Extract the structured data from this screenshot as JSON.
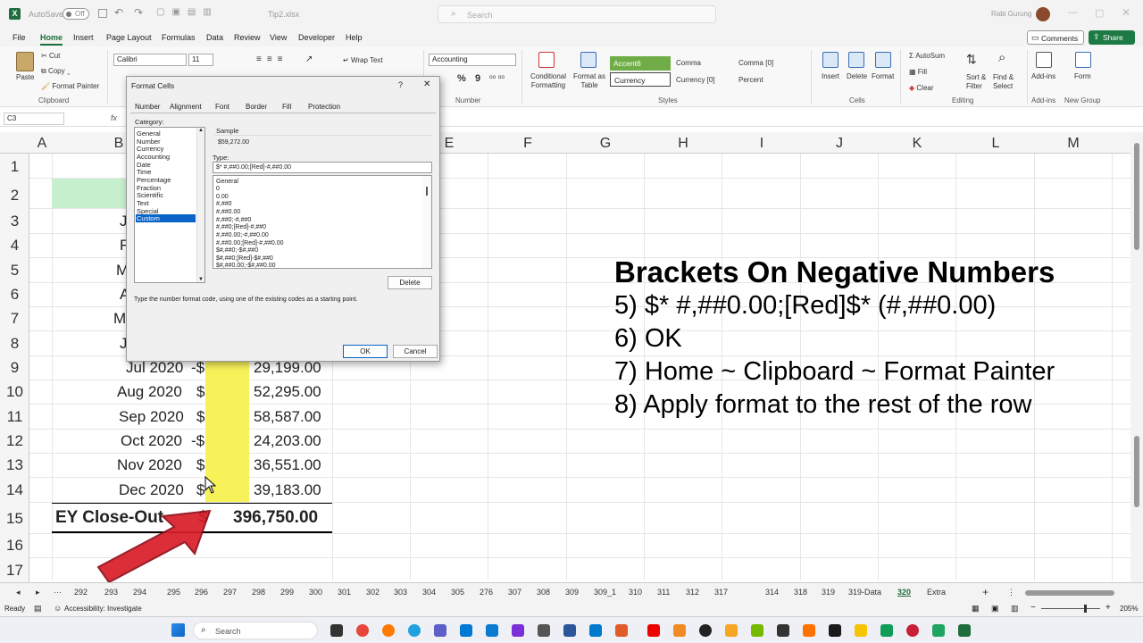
{
  "app": {
    "autosave_label": "AutoSave",
    "autosave_state": "Off",
    "filename": "Tip2.xlsx",
    "search_placeholder": "Search",
    "user_name": "Rabi Gurung"
  },
  "menu": [
    "File",
    "Home",
    "Insert",
    "Page Layout",
    "Formulas",
    "Data",
    "Review",
    "View",
    "Developer",
    "Help"
  ],
  "menu_active": "Home",
  "header_buttons": {
    "comments": "Comments",
    "share": "Share"
  },
  "ribbon": {
    "paste": "Paste",
    "cut": "Cut",
    "copy": "Copy",
    "format_painter": "Format Painter",
    "clipboard": "Clipboard",
    "font_name": "Calibri",
    "font_size": "11",
    "wrap_text": "Wrap Text",
    "number_format": "Accounting",
    "number_group": "Number",
    "percent_symbol": "%",
    "comma_symbol": "9",
    "conditional_formatting": "Conditional Formatting",
    "format_as_table": "Format as Table",
    "style_accent6": "Accent6",
    "style_comma": "Comma",
    "style_comma0": "Comma [0]",
    "style_currency": "Currency",
    "style_currency0": "Currency [0]",
    "style_percent": "Percent",
    "styles_group": "Styles",
    "insert": "Insert",
    "delete": "Delete",
    "format": "Format",
    "cells_group": "Cells",
    "autosum": "AutoSum",
    "fill": "Fill",
    "clear": "Clear",
    "sort_filter": "Sort & Filter",
    "find_select": "Find & Select",
    "editing_group": "Editing",
    "addins": "Add-ins",
    "addins_group": "Add-ins",
    "form": "Form",
    "new_group": "New Group"
  },
  "formula_bar": {
    "name_box": "C3",
    "fx": "fx"
  },
  "columns": [
    "A",
    "B",
    "E",
    "F",
    "G",
    "H",
    "I",
    "J",
    "K",
    "L",
    "M"
  ],
  "rows": [
    "1",
    "2",
    "3",
    "4",
    "5",
    "6",
    "7",
    "8",
    "9",
    "10",
    "11",
    "12",
    "13",
    "14",
    "15",
    "16",
    "17"
  ],
  "partial_b_letters": [
    "J",
    "F",
    "M",
    "A",
    "M",
    "J"
  ],
  "data_rows": [
    {
      "month": "Jul 2020",
      "sym": "-$",
      "amount": "29,199.00"
    },
    {
      "month": "Aug 2020",
      "sym": "$",
      "amount": "52,295.00"
    },
    {
      "month": "Sep 2020",
      "sym": "$",
      "amount": "58,587.00"
    },
    {
      "month": "Oct 2020",
      "sym": "-$",
      "amount": "24,203.00"
    },
    {
      "month": "Nov 2020",
      "sym": "$",
      "amount": "36,551.00"
    },
    {
      "month": "Dec 2020",
      "sym": "$",
      "amount": "39,183.00"
    }
  ],
  "total_row": {
    "label": "EY Close-Out",
    "sym": "$",
    "amount": "396,750.00"
  },
  "dialog": {
    "title": "Format Cells",
    "help": "?",
    "tabs": [
      "Number",
      "Alignment",
      "Font",
      "Border",
      "Fill",
      "Protection"
    ],
    "category_label": "Category:",
    "categories": [
      "General",
      "Number",
      "Currency",
      "Accounting",
      "Date",
      "Time",
      "Percentage",
      "Fraction",
      "Scientific",
      "Text",
      "Special",
      "Custom"
    ],
    "selected_category": "Custom",
    "sample_label": "Sample",
    "sample_value": "$59,272.00",
    "type_label": "Type:",
    "type_value": "$* #,##0.00;[Red]-#,##0.00",
    "type_list": [
      "General",
      "0",
      "0.00",
      "#,##0",
      "#,##0.00",
      "#,##0;-#,##0",
      "#,##0;[Red]-#,##0",
      "#,##0.00;-#,##0.00",
      "#,##0.00;[Red]-#,##0.00",
      "$#,##0;-$#,##0",
      "$#,##0;[Red]-$#,##0",
      "$#,##0.00;-$#,##0.00"
    ],
    "delete": "Delete",
    "hint": "Type the number format code, using one of the existing codes as a starting point.",
    "ok": "OK",
    "cancel": "Cancel"
  },
  "instructions": {
    "title": "Brackets On Negative Numbers",
    "steps": [
      "5) $* #,##0.00;[Red]$* (#,##0.00)",
      "6) OK",
      "7) Home ~ Clipboard ~ Format Painter",
      "8) Apply format to the rest of the row"
    ]
  },
  "sheet_tabs": [
    "292",
    "293",
    "294",
    "295",
    "296",
    "297",
    "298",
    "299",
    "300",
    "301",
    "302",
    "303",
    "304",
    "305",
    "276",
    "307",
    "308",
    "309",
    "309_1",
    "310",
    "311",
    "312",
    "317",
    "314",
    "318",
    "319",
    "319-Data",
    "320",
    "Extra"
  ],
  "active_sheet": "320",
  "status": {
    "ready": "Ready",
    "accessibility": "Accessibility: Investigate",
    "zoom": "205%"
  },
  "taskbar": {
    "search": "Search"
  },
  "colors": {
    "excel_green": "#1e6d3c",
    "highlight_yellow": "#f7f25a",
    "arrow_red": "#d91f2b",
    "header_green": "#c6efce"
  }
}
